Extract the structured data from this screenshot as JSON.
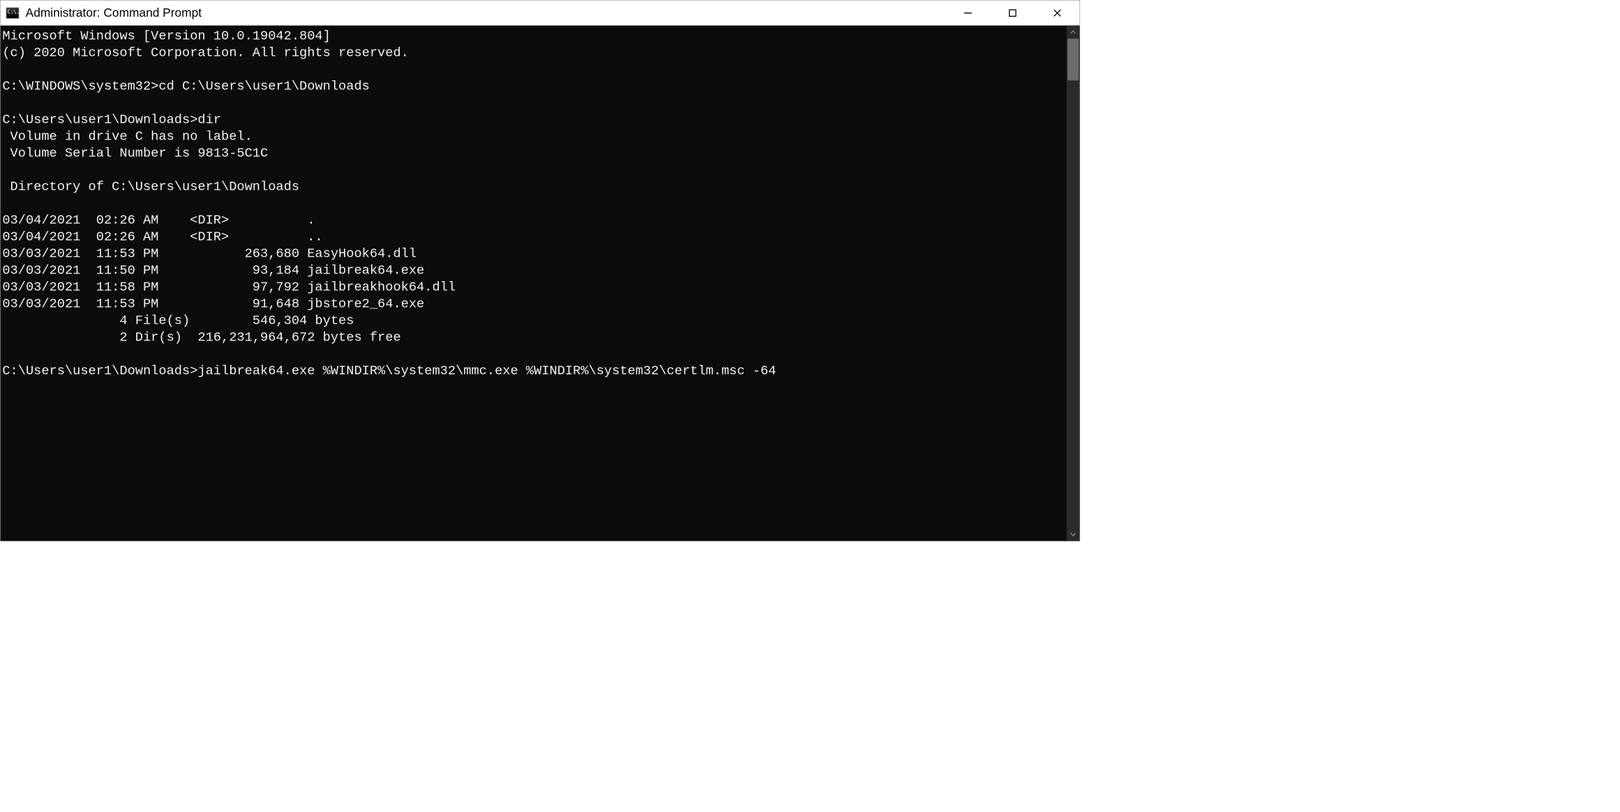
{
  "titlebar": {
    "title": "Administrator: Command Prompt",
    "icon_text": "C:\\."
  },
  "terminal": {
    "banner_version": "Microsoft Windows [Version 10.0.19042.804]",
    "banner_copyright": "(c) 2020 Microsoft Corporation. All rights reserved.",
    "prompt1_path": "C:\\WINDOWS\\system32>",
    "prompt1_cmd": "cd C:\\Users\\user1\\Downloads",
    "prompt2_path": "C:\\Users\\user1\\Downloads>",
    "prompt2_cmd": "dir",
    "dir": {
      "volume_line": " Volume in drive C has no label.",
      "serial_line": " Volume Serial Number is 9813-5C1C",
      "directory_label_line": " Directory of C:\\Users\\user1\\Downloads",
      "entries": [
        "03/04/2021  02:26 AM    <DIR>          .",
        "03/04/2021  02:26 AM    <DIR>          ..",
        "03/03/2021  11:53 PM           263,680 EasyHook64.dll",
        "03/03/2021  11:50 PM            93,184 jailbreak64.exe",
        "03/03/2021  11:58 PM            97,792 jailbreakhook64.dll",
        "03/03/2021  11:53 PM            91,648 jbstore2_64.exe"
      ],
      "summary_files": "               4 File(s)        546,304 bytes",
      "summary_dirs": "               2 Dir(s)  216,231,964,672 bytes free"
    },
    "prompt3_path": "C:\\Users\\user1\\Downloads>",
    "prompt3_cmd": "jailbreak64.exe %WINDIR%\\system32\\mmc.exe %WINDIR%\\system32\\certlm.msc -64"
  }
}
